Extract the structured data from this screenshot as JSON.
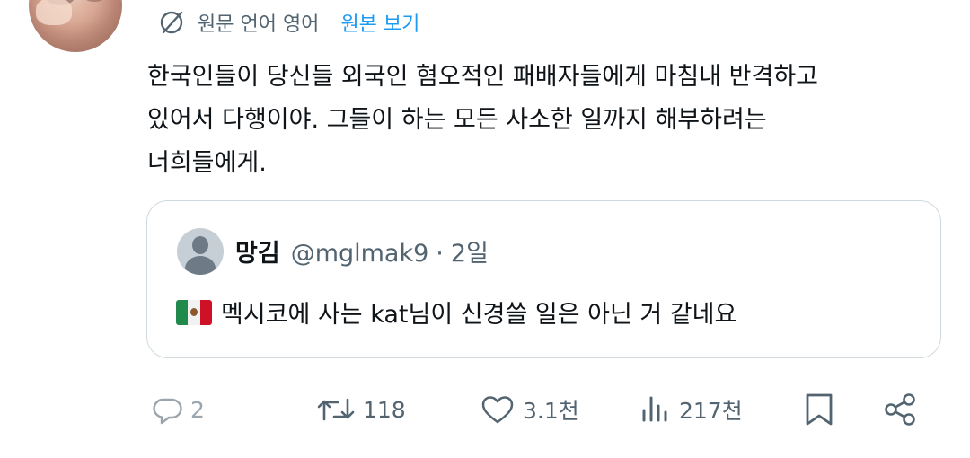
{
  "translate_bar": {
    "label": "원문 언어 영어",
    "show_original": "원본 보기"
  },
  "tweet": {
    "text": "한국인들이 당신들 외국인 혐오적인 패배자들에게 마침내 반격하고\n있어서 다행이야. 그들이 하는 모든 사소한 일까지 해부하려는\n너희들에게."
  },
  "quote": {
    "name": "망김",
    "handle": "@mglmak9",
    "separator": "·",
    "time": "2일",
    "flag_icon": "mexico-flag-icon",
    "text": "멕시코에 사는 kat님이 신경쓸 일은 아닌 거 같네요"
  },
  "actions": {
    "reply_count": "2",
    "retweet_count": "118",
    "like_count": "3.1천",
    "views_count": "217천"
  },
  "colors": {
    "link": "#1d9bf0",
    "secondary_text": "#536471",
    "border": "#cfd9de",
    "primary_text": "#0f1419"
  },
  "icons": [
    "globe-icon",
    "reply-icon",
    "retweet-icon",
    "like-icon",
    "views-icon",
    "bookmark-icon",
    "share-icon"
  ]
}
